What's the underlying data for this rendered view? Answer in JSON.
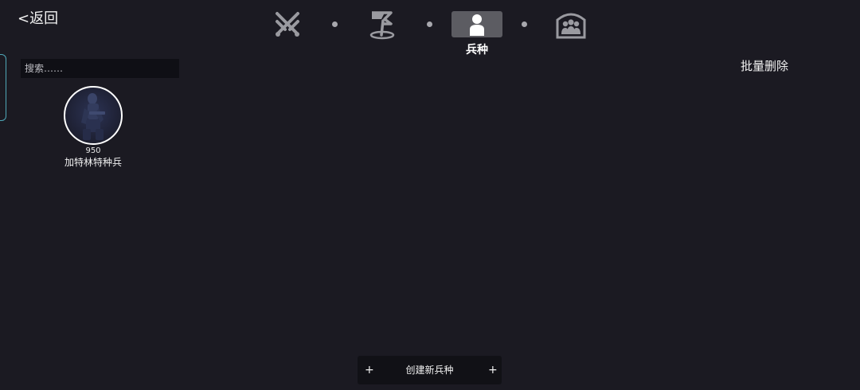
{
  "header": {
    "back_label": "<返回",
    "batch_delete_label": "批量删除"
  },
  "nav": {
    "items": [
      {
        "icon": "crossed-swords-icon",
        "active": false
      },
      {
        "icon": "flag-icon",
        "active": false
      },
      {
        "icon": "person-icon",
        "active": true,
        "label": "兵种"
      },
      {
        "icon": "group-icon",
        "active": false
      }
    ]
  },
  "search": {
    "placeholder": "搜索……"
  },
  "units": [
    {
      "cost": "950",
      "name": "加特林特种兵",
      "icon": "soldier-portrait"
    }
  ],
  "footer": {
    "create_label": "创建新兵种",
    "plus_symbol": "+"
  },
  "colors": {
    "background": "#1b1a22",
    "active_tab": "#5c5c62",
    "accent_border": "#4fa7b8"
  }
}
